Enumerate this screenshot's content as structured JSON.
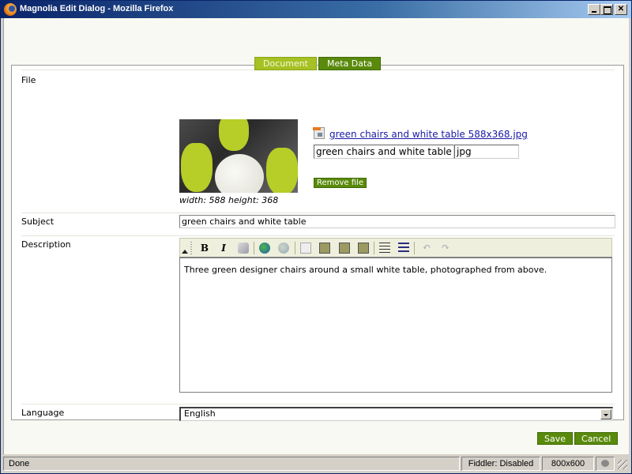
{
  "window": {
    "title": "Magnolia Edit Dialog - Mozilla Firefox",
    "controls": {
      "minimize": "minimize",
      "maximize": "maximize",
      "close": "✕"
    }
  },
  "tabs": [
    {
      "label": "Document",
      "active": false
    },
    {
      "label": "Meta Data",
      "active": true
    }
  ],
  "form": {
    "file": {
      "label": "File",
      "link_text": "green chairs and white table 588x368.jpg",
      "name_value": "green chairs and white table 588x368",
      "extension_value": "jpg",
      "remove_label": "Remove file",
      "dimensions": "width: 588 height: 368"
    },
    "subject": {
      "label": "Subject",
      "value": "green chairs and white table"
    },
    "description": {
      "label": "Description",
      "toolbar": [
        "collapse",
        "bold",
        "italic",
        "remove-format",
        "insert-link",
        "remove-link",
        "copy",
        "paste",
        "paste-as-text",
        "paste-from-word",
        "ordered-list",
        "unordered-list",
        "undo",
        "redo"
      ],
      "bold_glyph": "B",
      "italic_glyph": "I",
      "value": "Three green designer chairs around a small white table, photographed from above."
    },
    "language": {
      "label": "Language",
      "selected": "English"
    }
  },
  "actions": {
    "save": "Save",
    "cancel": "Cancel"
  },
  "colors": {
    "tab_inactive": "#a6c124",
    "accent_green": "#5a8a0c",
    "link": "#1a1aa6"
  },
  "statusbar": {
    "status": "Done",
    "fiddler": "Fiddler: Disabled",
    "size": "800x600"
  }
}
